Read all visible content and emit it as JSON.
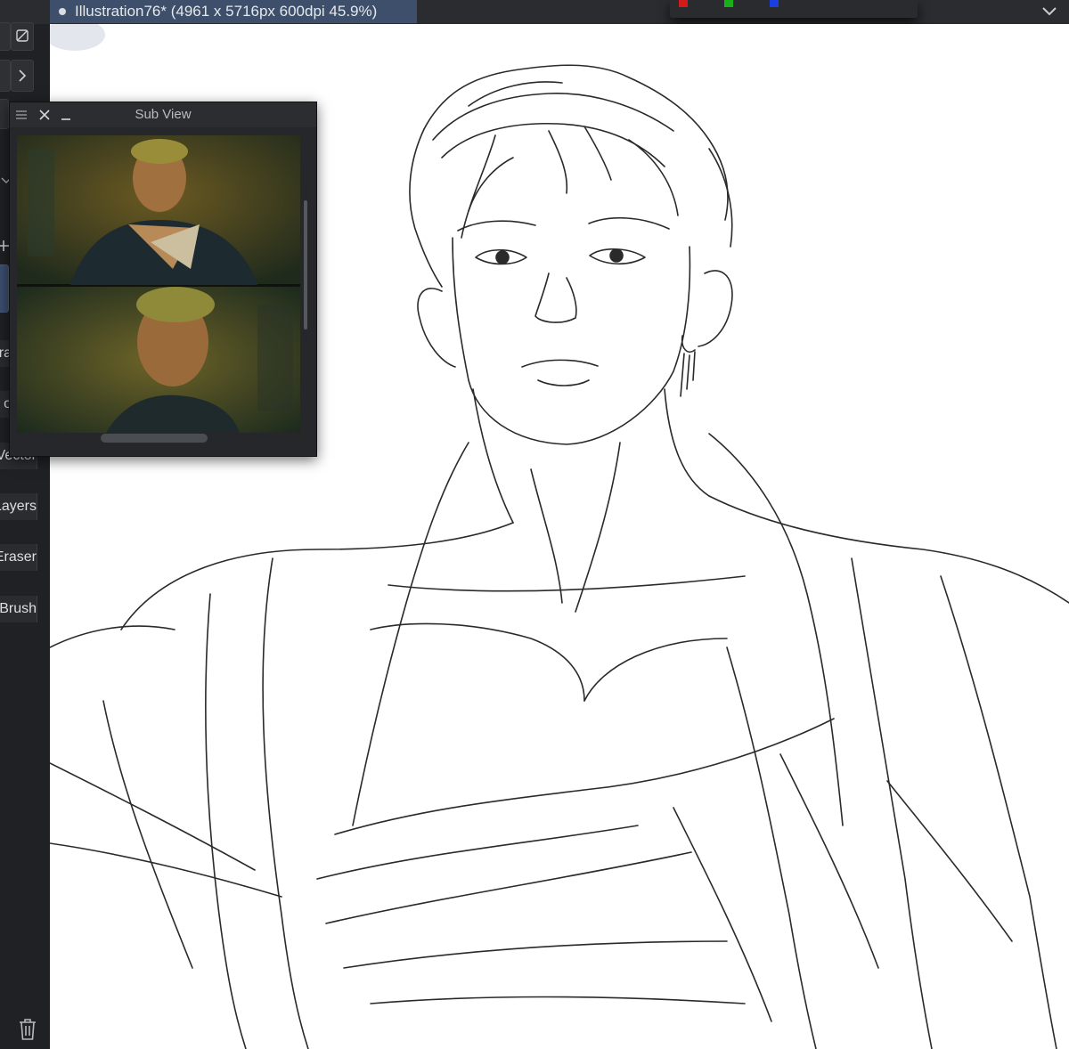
{
  "document_tab": {
    "title": "Illustration76* (4961 x 5716px 600dpi 45.9%)"
  },
  "color_swatches": [
    "#d11a1a",
    "#18b018",
    "#1a3ee0"
  ],
  "left_panel": {
    "labels": [
      {
        "id": "vector",
        "text": "Vector"
      },
      {
        "id": "layers",
        "text": "Layers"
      },
      {
        "id": "eraser",
        "text": "Eraser"
      },
      {
        "id": "brush",
        "text": "Brush"
      }
    ],
    "partial_glyphs": [
      "+",
      "S",
      "ra",
      "o"
    ]
  },
  "sub_view": {
    "title": "Sub View"
  },
  "colors": {
    "app_bg": "#1e1f21",
    "tab_active": "#3d4f6a",
    "canvas": "#ffffff",
    "sketch_line": "#2a2a2a"
  },
  "icons": [
    "close-icon",
    "minimize-icon",
    "menu-icon",
    "chevron-down-icon",
    "chevron-right-icon",
    "trash-icon",
    "transparency-icon"
  ]
}
